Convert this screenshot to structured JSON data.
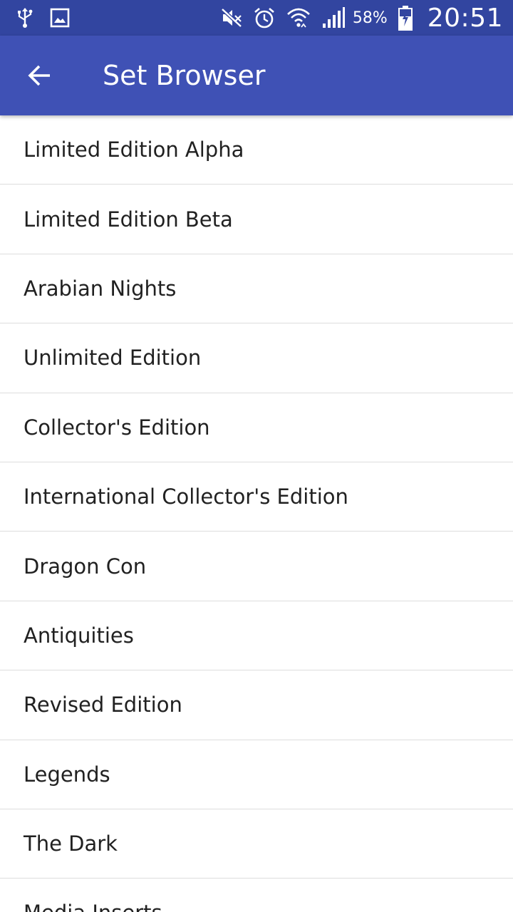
{
  "status_bar": {
    "battery_percent": "58%",
    "time": "20:51",
    "icons": [
      "usb-icon",
      "image-icon",
      "mute-icon",
      "alarm-icon",
      "wifi-icon",
      "signal-icon",
      "battery-charging-icon"
    ]
  },
  "app_bar": {
    "title": "Set Browser",
    "back_icon": "arrow-back-icon",
    "background": "#3f51b5"
  },
  "sets": [
    {
      "label": "Limited Edition Alpha"
    },
    {
      "label": "Limited Edition Beta"
    },
    {
      "label": "Arabian Nights"
    },
    {
      "label": "Unlimited Edition"
    },
    {
      "label": "Collector's Edition"
    },
    {
      "label": "International Collector's Edition"
    },
    {
      "label": "Dragon Con"
    },
    {
      "label": "Antiquities"
    },
    {
      "label": "Revised Edition"
    },
    {
      "label": "Legends"
    },
    {
      "label": "The Dark"
    },
    {
      "label": "Media Inserts"
    }
  ]
}
